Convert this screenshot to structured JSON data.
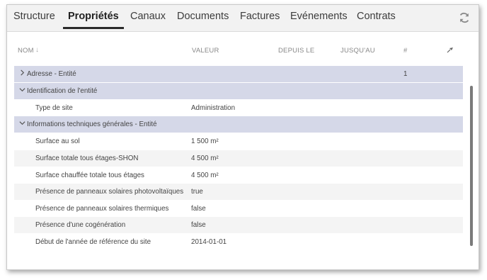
{
  "tabs": [
    {
      "label": "Structure"
    },
    {
      "label": "Propriétés",
      "active": true
    },
    {
      "label": "Canaux"
    },
    {
      "label": "Documents"
    },
    {
      "label": "Factures"
    },
    {
      "label": "Evénements"
    },
    {
      "label": "Contrats"
    }
  ],
  "icons": {
    "refresh": "refresh-icon",
    "sort": "arrow-down-icon",
    "pin": "pin-icon",
    "chevron_right": "chevron-right-icon",
    "chevron_down": "chevron-down-icon"
  },
  "columns": {
    "nom": "NOM",
    "valeur": "VALEUR",
    "depuis": "DEPUIS LE",
    "jusqu": "JUSQU'AU",
    "count": "#"
  },
  "rows": [
    {
      "type": "group",
      "expanded": false,
      "label": "Adresse - Entité",
      "count": "1"
    },
    {
      "type": "group",
      "expanded": true,
      "label": "Identification de l'entité",
      "count": ""
    },
    {
      "type": "prop",
      "label": "Type de site",
      "value": "Administration"
    },
    {
      "type": "group",
      "expanded": true,
      "label": "Informations techniques générales - Entité",
      "count": ""
    },
    {
      "type": "prop",
      "label": "Surface au sol",
      "value": "1 500 m²"
    },
    {
      "type": "prop",
      "label": "Surface totale tous étages-SHON",
      "value": "4 500 m²"
    },
    {
      "type": "prop",
      "label": "Surface chauffée totale tous étages",
      "value": "4 500 m²"
    },
    {
      "type": "prop",
      "label": "Présence de panneaux solaires photovoltaïques",
      "value": "true"
    },
    {
      "type": "prop",
      "label": "Présence de panneaux solaires thermiques",
      "value": "false"
    },
    {
      "type": "prop",
      "label": "Présence d'une cogénération",
      "value": "false"
    },
    {
      "type": "prop",
      "label": "Début de l'année de référence du site",
      "value": "2014-01-01"
    }
  ],
  "colors": {
    "group_bg": "#d5d8e8",
    "alt_bg": "#f4f4f4",
    "tabbar_bg": "#f2f2f2",
    "underline": "#2a2a2a"
  }
}
